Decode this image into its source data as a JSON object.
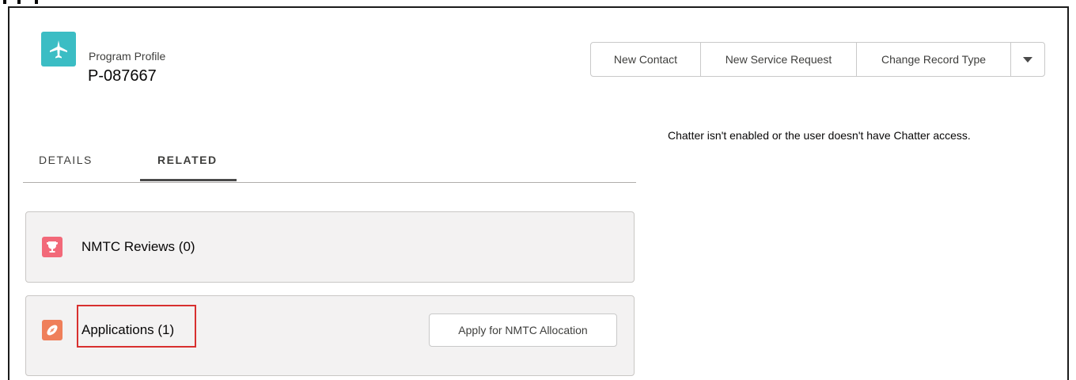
{
  "header": {
    "record_type": "Program Profile",
    "record_name": "P-087667",
    "icon": "airplane-icon",
    "icon_color": "#3bbdc4"
  },
  "actions": {
    "buttons": [
      "New Contact",
      "New Service Request",
      "Change Record Type"
    ],
    "more_icon": "caret-down-icon"
  },
  "chatter": {
    "message": "Chatter isn't enabled or the user doesn't have Chatter access."
  },
  "tabs": [
    {
      "label": "DETAILS",
      "active": false
    },
    {
      "label": "RELATED",
      "active": true
    }
  ],
  "related_lists": [
    {
      "title": "NMTC Reviews (0)",
      "icon": "trophy-icon",
      "icon_color": "#f26979"
    },
    {
      "title": "Applications (1)",
      "icon": "football-icon",
      "icon_color": "#ef7f5a",
      "action_label": "Apply for NMTC Allocation"
    }
  ]
}
